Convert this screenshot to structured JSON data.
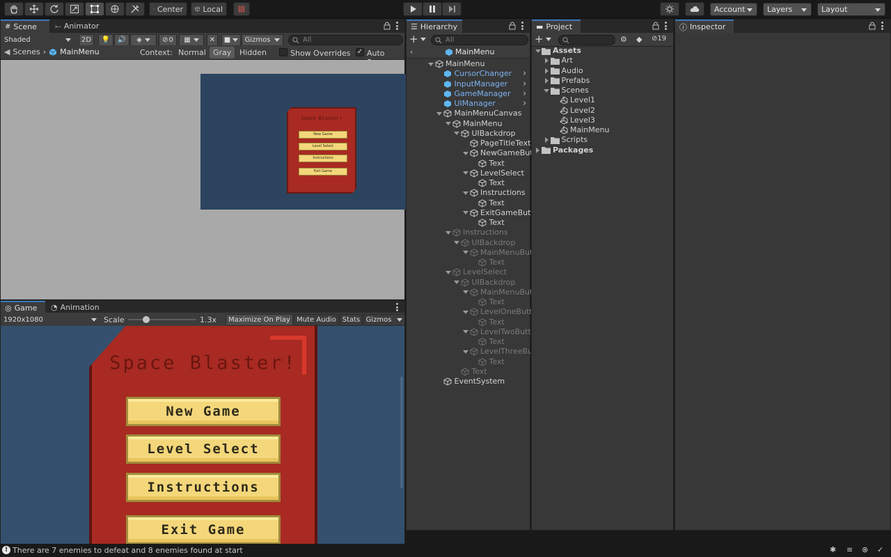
{
  "toolbar": {
    "tools": [
      "hand-tool",
      "move-tool",
      "rotate-tool",
      "scale-tool",
      "rect-tool",
      "transform-tool",
      "custom-tool"
    ],
    "pivot_label": "Center",
    "space_label": "Local",
    "account_label": "Account",
    "layers_label": "Layers",
    "layout_label": "Layout"
  },
  "scene": {
    "tabs": [
      "Scene",
      "Animator"
    ],
    "draw_mode": "Shaded",
    "mode_2d": "2D",
    "gizmo_count": "0",
    "gizmos_label": "Gizmos",
    "search_placeholder": "All",
    "breadcrumb_root": "Scenes",
    "breadcrumb_current": "MainMenu",
    "context_label": "Context:",
    "context_options": [
      "Normal",
      "Gray",
      "Hidden"
    ],
    "show_overrides_label": "Show Overrides",
    "auto_save_label": "Auto Save",
    "preview": {
      "title": "Space Blaster!",
      "buttons": [
        "New Game",
        "Level Select",
        "Instructions",
        "Exit Game"
      ]
    }
  },
  "game": {
    "tabs": [
      "Game",
      "Animation"
    ],
    "resolution": "1920x1080",
    "scale_label": "Scale",
    "scale_value": "1.3x",
    "buttons": [
      "Maximize On Play",
      "Mute Audio",
      "Stats",
      "Gizmos"
    ],
    "title": "Space Blaster!",
    "menu_buttons": [
      "New Game",
      "Level Select",
      "Instructions",
      "Exit Game"
    ]
  },
  "hierarchy": {
    "tab": "Hierarchy",
    "search_placeholder": "All",
    "scene_title": "MainMenu",
    "rows": [
      {
        "label": "MainMenu",
        "depth": 0,
        "fold": "open",
        "style": "normal"
      },
      {
        "label": "CursorChanger",
        "depth": 1,
        "fold": "none",
        "style": "blue",
        "arrow": true
      },
      {
        "label": "InputManager",
        "depth": 1,
        "fold": "none",
        "style": "blue",
        "arrow": true
      },
      {
        "label": "GameManager",
        "depth": 1,
        "fold": "none",
        "style": "blue",
        "arrow": true
      },
      {
        "label": "UIManager",
        "depth": 1,
        "fold": "none",
        "style": "blue",
        "arrow": true
      },
      {
        "label": "MainMenuCanvas",
        "depth": 1,
        "fold": "open",
        "style": "normal"
      },
      {
        "label": "MainMenu",
        "depth": 2,
        "fold": "open",
        "style": "normal"
      },
      {
        "label": "UIBackdrop",
        "depth": 3,
        "fold": "open",
        "style": "normal"
      },
      {
        "label": "PageTitleText",
        "depth": 4,
        "fold": "none",
        "style": "normal"
      },
      {
        "label": "NewGameBut",
        "depth": 4,
        "fold": "open",
        "style": "normal"
      },
      {
        "label": "Text",
        "depth": 5,
        "fold": "none",
        "style": "normal"
      },
      {
        "label": "LevelSelect",
        "depth": 4,
        "fold": "open",
        "style": "normal"
      },
      {
        "label": "Text",
        "depth": 5,
        "fold": "none",
        "style": "normal"
      },
      {
        "label": "Instructions",
        "depth": 4,
        "fold": "open",
        "style": "normal"
      },
      {
        "label": "Text",
        "depth": 5,
        "fold": "none",
        "style": "normal"
      },
      {
        "label": "ExitGameButto",
        "depth": 4,
        "fold": "open",
        "style": "normal"
      },
      {
        "label": "Text",
        "depth": 5,
        "fold": "none",
        "style": "normal"
      },
      {
        "label": "Instructions",
        "depth": 2,
        "fold": "open",
        "style": "dim"
      },
      {
        "label": "UIBackdrop",
        "depth": 3,
        "fold": "open",
        "style": "dim"
      },
      {
        "label": "MainMenuBut",
        "depth": 4,
        "fold": "open",
        "style": "dim"
      },
      {
        "label": "Text",
        "depth": 5,
        "fold": "none",
        "style": "dim"
      },
      {
        "label": "LevelSelect",
        "depth": 2,
        "fold": "open",
        "style": "dim"
      },
      {
        "label": "UIBackdrop",
        "depth": 3,
        "fold": "open",
        "style": "dim"
      },
      {
        "label": "MainMenuBut",
        "depth": 4,
        "fold": "open",
        "style": "dim"
      },
      {
        "label": "Text",
        "depth": 5,
        "fold": "none",
        "style": "dim"
      },
      {
        "label": "LevelOneButto",
        "depth": 4,
        "fold": "open",
        "style": "dim"
      },
      {
        "label": "Text",
        "depth": 5,
        "fold": "none",
        "style": "dim"
      },
      {
        "label": "LevelTwoButt",
        "depth": 4,
        "fold": "open",
        "style": "dim"
      },
      {
        "label": "Text",
        "depth": 5,
        "fold": "none",
        "style": "dim"
      },
      {
        "label": "LevelThreeBu",
        "depth": 4,
        "fold": "open",
        "style": "dim"
      },
      {
        "label": "Text",
        "depth": 5,
        "fold": "none",
        "style": "dim"
      },
      {
        "label": "Text",
        "depth": 3,
        "fold": "none",
        "style": "dim"
      },
      {
        "label": "EventSystem",
        "depth": 1,
        "fold": "none",
        "style": "normal"
      }
    ]
  },
  "project": {
    "tab": "Project",
    "hidden_count": "19",
    "rows": [
      {
        "label": "Assets",
        "depth": 0,
        "fold": "open",
        "kind": "folder",
        "bold": true
      },
      {
        "label": "Art",
        "depth": 1,
        "fold": "closed",
        "kind": "folder"
      },
      {
        "label": "Audio",
        "depth": 1,
        "fold": "closed",
        "kind": "folder"
      },
      {
        "label": "Prefabs",
        "depth": 1,
        "fold": "closed",
        "kind": "folder"
      },
      {
        "label": "Scenes",
        "depth": 1,
        "fold": "open",
        "kind": "folder"
      },
      {
        "label": "Level1",
        "depth": 2,
        "fold": "none",
        "kind": "scene"
      },
      {
        "label": "Level2",
        "depth": 2,
        "fold": "none",
        "kind": "scene"
      },
      {
        "label": "Level3",
        "depth": 2,
        "fold": "none",
        "kind": "scene"
      },
      {
        "label": "MainMenu",
        "depth": 2,
        "fold": "none",
        "kind": "scene"
      },
      {
        "label": "Scripts",
        "depth": 1,
        "fold": "closed",
        "kind": "folder"
      },
      {
        "label": "Packages",
        "depth": 0,
        "fold": "closed",
        "kind": "folder",
        "bold": true
      }
    ]
  },
  "inspector": {
    "tab": "Inspector"
  },
  "status": {
    "message": "There are 7 enemies to defeat and 8 enemies found at start"
  },
  "colors": {
    "accent": "#3a79bb",
    "game_bg": "#34506e",
    "menu_red": "#a82a22",
    "button_yellow": "#f4d77a"
  }
}
